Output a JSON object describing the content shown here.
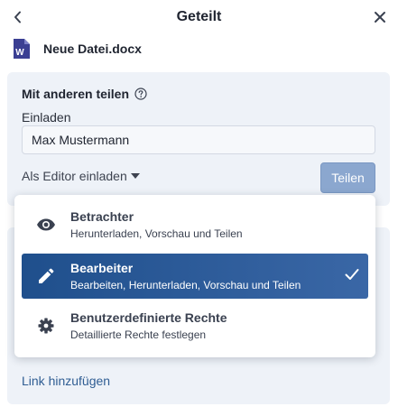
{
  "header": {
    "title": "Geteilt",
    "back_icon": "chevron-left-icon",
    "close_icon": "close-icon"
  },
  "file": {
    "name": "Neue Datei.docx",
    "icon": "word-document-icon",
    "icon_letter": "W",
    "icon_color": "#3b3f93"
  },
  "share": {
    "title": "Mit anderen teilen",
    "invite_label": "Einladen",
    "invite_value": "Max Mustermann",
    "role_label": "Als Editor einladen",
    "share_button": "Teilen"
  },
  "options": [
    {
      "title": "Betrachter",
      "desc": "Herunterladen, Vorschau und Teilen",
      "icon": "eye-icon"
    },
    {
      "title": "Bearbeiter",
      "desc": "Bearbeiten, Herunterladen, Vorschau und Teilen",
      "icon": "pencil-icon",
      "selected": true
    },
    {
      "title": "Benutzerdefinierte Rechte",
      "desc": "Detaillierte Rechte festlegen",
      "icon": "gear-icon"
    }
  ],
  "link": {
    "label": "Link hinzufügen"
  },
  "colors": {
    "accent": "#1f4f8c",
    "panel": "#eef2f8",
    "share_button": "#8ba7cf",
    "link": "#2f5d93"
  }
}
